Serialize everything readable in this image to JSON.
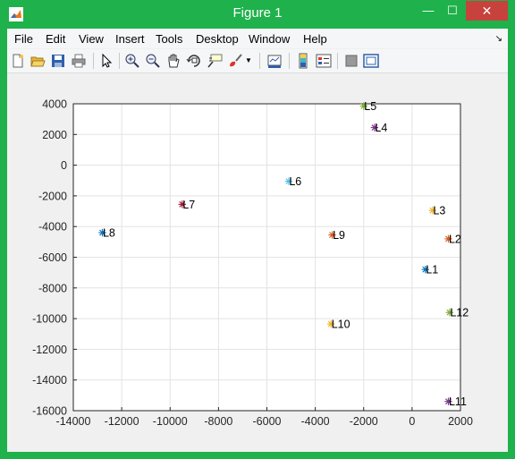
{
  "window": {
    "title": "Figure 1",
    "minimize": "—",
    "maximize": "☐",
    "close": "✕"
  },
  "menu": [
    "File",
    "Edit",
    "View",
    "Insert",
    "Tools",
    "Desktop",
    "Window",
    "Help"
  ],
  "toolbar": {
    "icons": [
      "new-figure-icon",
      "open-file-icon",
      "save-icon",
      "print-icon",
      "pointer-icon",
      "zoom-in-icon",
      "zoom-out-icon",
      "pan-icon",
      "rotate-3d-icon",
      "data-cursor-icon",
      "brush-icon",
      "brush-dropdown-icon",
      "link-plot-icon",
      "colorbar-icon",
      "legend-icon",
      "hide-plot-tools-icon",
      "show-plot-tools-icon"
    ]
  },
  "chart_data": {
    "type": "scatter",
    "xlim": [
      -14000,
      2000
    ],
    "ylim": [
      -16000,
      4000
    ],
    "xticks": [
      "-14000",
      "-12000",
      "-10000",
      "-8000",
      "-6000",
      "-4000",
      "-2000",
      "0",
      "2000"
    ],
    "yticks": [
      "4000",
      "2000",
      "0",
      "-2000",
      "-4000",
      "-6000",
      "-8000",
      "-10000",
      "-12000",
      "-14000",
      "-16000"
    ],
    "xtick_values": [
      -14000,
      -12000,
      -10000,
      -8000,
      -6000,
      -4000,
      -2000,
      0,
      2000
    ],
    "ytick_values": [
      4000,
      2000,
      0,
      -2000,
      -4000,
      -6000,
      -8000,
      -10000,
      -12000,
      -14000,
      -16000
    ],
    "grid": true,
    "marker": "*",
    "points": [
      {
        "label": "L1",
        "x": 550,
        "y": -6800,
        "color": "#0072bd"
      },
      {
        "label": "L2",
        "x": 1500,
        "y": -4800,
        "color": "#d95319"
      },
      {
        "label": "L3",
        "x": 850,
        "y": -2950,
        "color": "#edb120"
      },
      {
        "label": "L4",
        "x": -1550,
        "y": 2450,
        "color": "#7e2f8e"
      },
      {
        "label": "L5",
        "x": -2000,
        "y": 3850,
        "color": "#77ac30"
      },
      {
        "label": "L6",
        "x": -5100,
        "y": -1050,
        "color": "#4dbeee"
      },
      {
        "label": "L7",
        "x": -9500,
        "y": -2550,
        "color": "#a2142f"
      },
      {
        "label": "L8",
        "x": -12800,
        "y": -4400,
        "color": "#0072bd"
      },
      {
        "label": "L9",
        "x": -3300,
        "y": -4550,
        "color": "#d95319"
      },
      {
        "label": "L10",
        "x": -3350,
        "y": -10350,
        "color": "#edb120"
      },
      {
        "label": "L11",
        "x": 1500,
        "y": -15400,
        "color": "#7e2f8e"
      },
      {
        "label": "L12",
        "x": 1550,
        "y": -9600,
        "color": "#77ac30"
      }
    ]
  }
}
